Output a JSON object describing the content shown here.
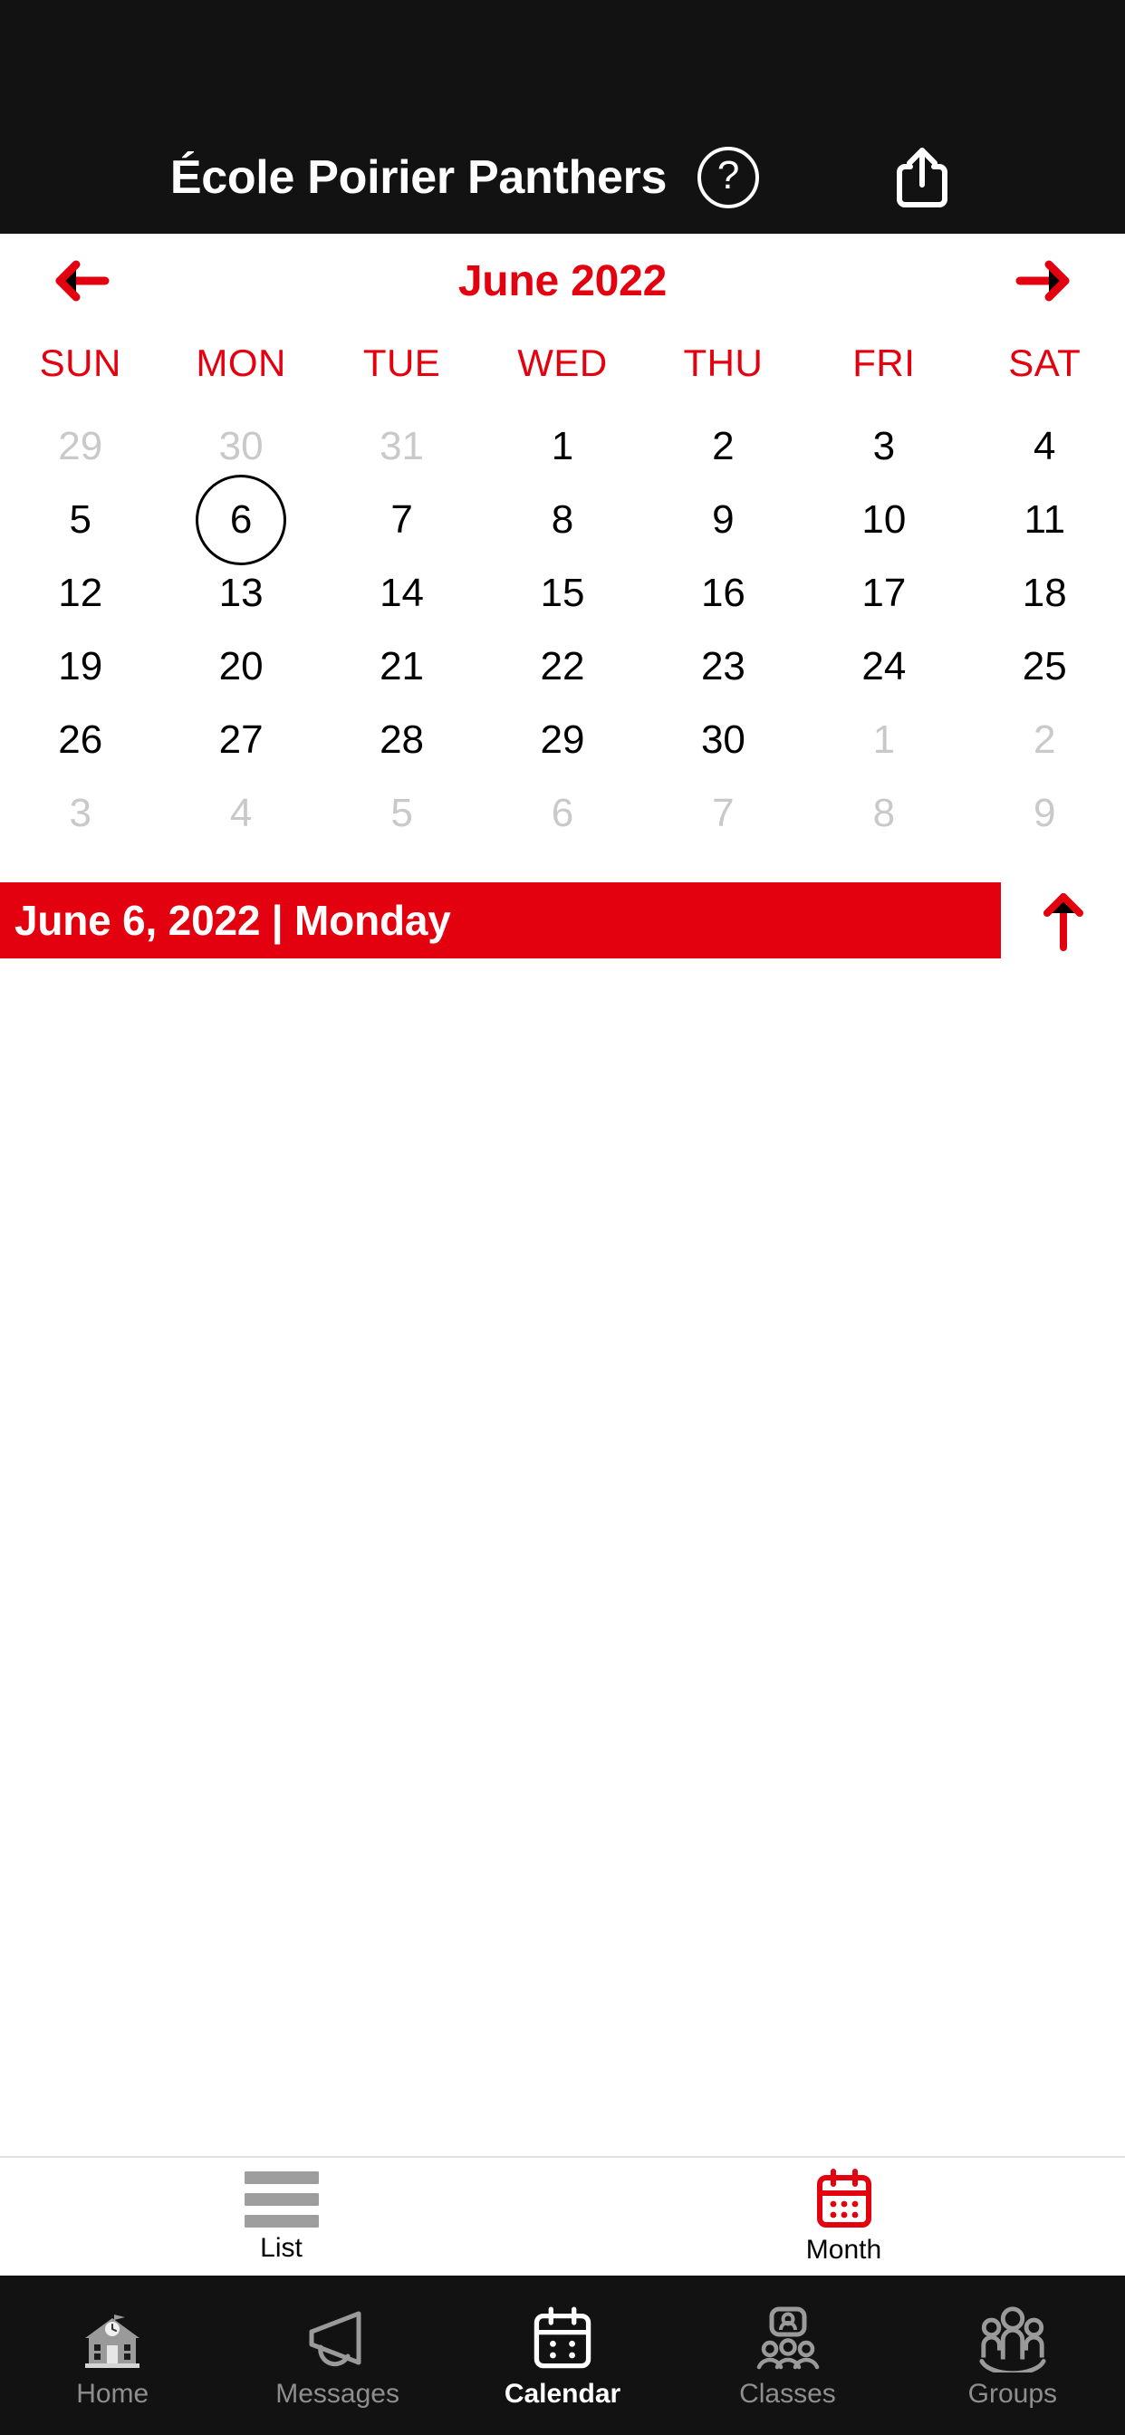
{
  "header": {
    "title": "École Poirier Panthers",
    "help_icon": "help-circle-icon",
    "help_glyph": "?",
    "share_icon": "share-icon",
    "background_color": "#121212",
    "text_color": "#FFFFFF"
  },
  "month_nav": {
    "prev_icon": "arrow-left-icon",
    "next_icon": "arrow-right-icon",
    "label": "June 2022",
    "accent_color": "#E3000F"
  },
  "calendar": {
    "weekdays": [
      "SUN",
      "MON",
      "TUE",
      "WED",
      "THU",
      "FRI",
      "SAT"
    ],
    "selected_day": 6,
    "weeks": [
      [
        {
          "n": "29",
          "muted": true
        },
        {
          "n": "30",
          "muted": true
        },
        {
          "n": "31",
          "muted": true
        },
        {
          "n": "1",
          "muted": false
        },
        {
          "n": "2",
          "muted": false
        },
        {
          "n": "3",
          "muted": false
        },
        {
          "n": "4",
          "muted": false
        }
      ],
      [
        {
          "n": "5",
          "muted": false
        },
        {
          "n": "6",
          "muted": false,
          "selected": true
        },
        {
          "n": "7",
          "muted": false
        },
        {
          "n": "8",
          "muted": false
        },
        {
          "n": "9",
          "muted": false
        },
        {
          "n": "10",
          "muted": false
        },
        {
          "n": "11",
          "muted": false
        }
      ],
      [
        {
          "n": "12",
          "muted": false
        },
        {
          "n": "13",
          "muted": false
        },
        {
          "n": "14",
          "muted": false
        },
        {
          "n": "15",
          "muted": false
        },
        {
          "n": "16",
          "muted": false
        },
        {
          "n": "17",
          "muted": false
        },
        {
          "n": "18",
          "muted": false
        }
      ],
      [
        {
          "n": "19",
          "muted": false
        },
        {
          "n": "20",
          "muted": false
        },
        {
          "n": "21",
          "muted": false
        },
        {
          "n": "22",
          "muted": false
        },
        {
          "n": "23",
          "muted": false
        },
        {
          "n": "24",
          "muted": false
        },
        {
          "n": "25",
          "muted": false
        }
      ],
      [
        {
          "n": "26",
          "muted": false
        },
        {
          "n": "27",
          "muted": false
        },
        {
          "n": "28",
          "muted": false
        },
        {
          "n": "29",
          "muted": false
        },
        {
          "n": "30",
          "muted": false
        },
        {
          "n": "1",
          "muted": true
        },
        {
          "n": "2",
          "muted": true
        }
      ],
      [
        {
          "n": "3",
          "muted": true
        },
        {
          "n": "4",
          "muted": true
        },
        {
          "n": "5",
          "muted": true
        },
        {
          "n": "6",
          "muted": true
        },
        {
          "n": "7",
          "muted": true
        },
        {
          "n": "8",
          "muted": true
        },
        {
          "n": "9",
          "muted": true
        }
      ]
    ]
  },
  "date_bar": {
    "text": "June 6, 2022 | Monday",
    "background_color": "#E3000F",
    "text_color": "#FFFFFF",
    "collapse_icon": "arrow-up-icon"
  },
  "view_tabs": [
    {
      "label": "List",
      "icon": "list-lines-icon",
      "active": false
    },
    {
      "label": "Month",
      "icon": "calendar-icon",
      "active": true
    }
  ],
  "bottom_nav": [
    {
      "label": "Home",
      "icon": "school-house-icon",
      "active": false
    },
    {
      "label": "Messages",
      "icon": "megaphone-icon",
      "active": false
    },
    {
      "label": "Calendar",
      "icon": "calendar-icon",
      "active": true
    },
    {
      "label": "Classes",
      "icon": "classroom-people-icon",
      "active": false
    },
    {
      "label": "Groups",
      "icon": "people-group-icon",
      "active": false
    }
  ]
}
